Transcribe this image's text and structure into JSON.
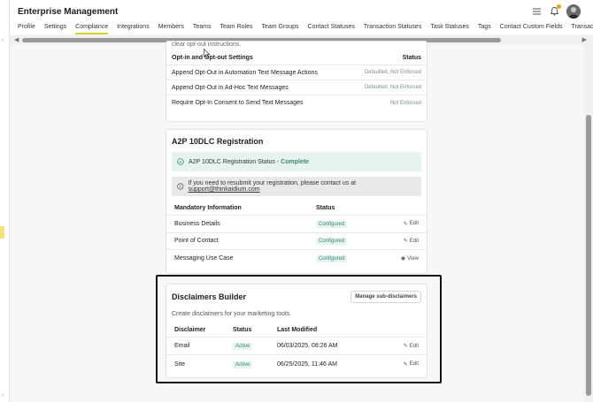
{
  "header": {
    "title": "Enterprise Management"
  },
  "tabs": [
    {
      "label": "Profile"
    },
    {
      "label": "Settings"
    },
    {
      "label": "Compliance",
      "active": true
    },
    {
      "label": "Integrations"
    },
    {
      "label": "Members"
    },
    {
      "label": "Teams"
    },
    {
      "label": "Team Roles"
    },
    {
      "label": "Team Groups"
    },
    {
      "label": "Contact Statuses"
    },
    {
      "label": "Transaction Statuses"
    },
    {
      "label": "Task Statuses"
    },
    {
      "label": "Tags"
    },
    {
      "label": "Contact Custom Fields"
    },
    {
      "label": "Transaction Cu"
    }
  ],
  "opt_card": {
    "intro_text": "clear opt-out instructions.",
    "col_setting": "Opt-in and Opt-out Settings",
    "col_status": "Status",
    "rows": [
      {
        "label": "Append Opt-Out in Automation Text Message Actions",
        "status": "Defaulted, Not Enforced"
      },
      {
        "label": "Append Opt-Out in Ad-Hoc Text Messages",
        "status": "Defaulted, Not Enforced"
      },
      {
        "label": "Require Opt-In Consent to Send Text Messages",
        "status": "Not Enforced"
      }
    ]
  },
  "a2p_card": {
    "title": "A2P 10DLC Registration",
    "status_text": "A2P 10DLC Registration Status - ",
    "status_value": "Complete",
    "info_text": "If you need to resubmit your registration, please contact us at ",
    "info_email": "support@thinkaidium.com",
    "col_info": "Mandatory Information",
    "col_status": "Status",
    "rows": [
      {
        "label": "Business Details",
        "status": "Configured",
        "action": "Edit"
      },
      {
        "label": "Point of Contact",
        "status": "Configured",
        "action": "Edit"
      },
      {
        "label": "Messaging Use Case",
        "status": "Configured",
        "action": "View"
      }
    ]
  },
  "disclaimers_card": {
    "title": "Disclaimers Builder",
    "manage_label": "Manage sub-disclaimers",
    "description": "Create disclaimers for your marketing tools.",
    "col_disclaimer": "Disclaimer",
    "col_status": "Status",
    "col_modified": "Last Modified",
    "rows": [
      {
        "label": "Email",
        "status": "Active",
        "modified": "06/03/2025, 08:26 AM",
        "action": "Edit"
      },
      {
        "label": "Site",
        "status": "Active",
        "modified": "06/25/2025, 11:46 AM",
        "action": "Edit"
      }
    ]
  },
  "colors": {
    "accent_underline": "#d4d428",
    "success_bg": "#e6f3ef",
    "success_text": "#3a8a74",
    "notification_badge": "#e7a412"
  }
}
